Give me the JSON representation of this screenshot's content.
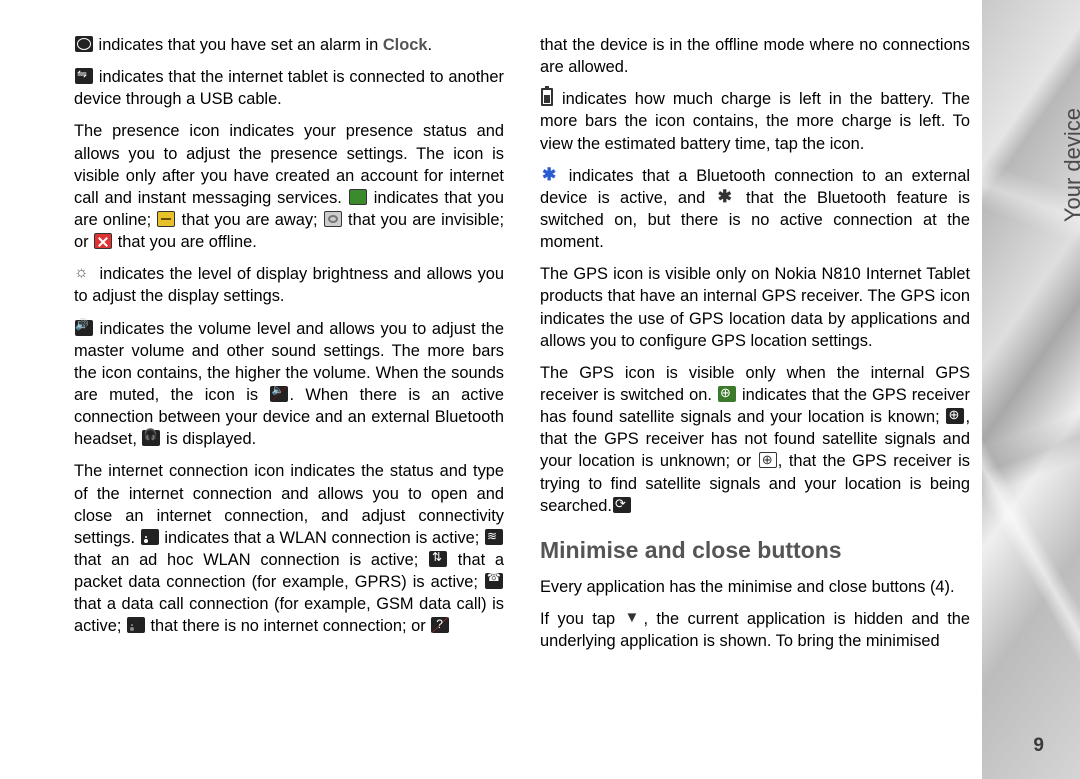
{
  "side_title": "Your device",
  "page_number": "9",
  "left": {
    "p1a": " indicates that you have set an alarm in ",
    "p1b": "Clock",
    "p1c": ".",
    "p2": " indicates that the internet tablet is connected to another device through a USB cable.",
    "p3a": "The presence icon indicates your presence status and allows you to adjust the presence settings. The icon is visible only after you have created an account for internet call and instant messaging services. ",
    "p3b": " indicates that you are online; ",
    "p3c": " that you are away; ",
    "p3d": " that you are invisible; or ",
    "p3e": " that you are offline.",
    "p4": " indicates the level of display brightness and allows you to adjust the display settings.",
    "p5a": " indicates the volume level and allows you to adjust the master volume and other sound settings. The more bars the icon contains, the higher the volume. When the sounds are muted, the icon is ",
    "p5b": ". When there is an active connection between your device and an external Bluetooth headset, ",
    "p5c": " is displayed.",
    "p6a": "The internet connection icon indicates the status and type of the internet connection and allows you to open and close an internet connection, and adjust connectivity settings. ",
    "p6b": " indicates that a WLAN connection is active; ",
    "p6c": " that an ad hoc WLAN connection is active; ",
    "p6d": " that a packet data connection (for example, GPRS) is active; ",
    "p6e": " that a data call connection (for example, GSM data call) is active; ",
    "p6f": " that there is no internet connection; or "
  },
  "right": {
    "p0": "that the device is in the offline mode where no connections are allowed.",
    "p1": " indicates how much charge is left in the battery. The more bars the icon contains, the more charge is left. To view the estimated battery time, tap the icon.",
    "p2a": " indicates that a Bluetooth connection to an external device is active, and ",
    "p2b": " that the Bluetooth feature is switched on, but there is no active connection at the moment.",
    "p3": "The GPS icon is visible only on Nokia N810 Internet Tablet products that have an internal GPS receiver. The GPS icon indicates the use of GPS location data by applications and allows you to configure GPS location settings.",
    "p4a": "The GPS icon is visible only when the internal GPS receiver is switched on. ",
    "p4b": " indicates that the GPS receiver has found satellite signals and your location is known; ",
    "p4c": ", that the GPS receiver has not found satellite signals and your location is unknown; or ",
    "p4d": ", that the GPS receiver is trying to find satellite signals and your location is being searched.",
    "h2": "Minimise and close buttons",
    "p5": "Every application has the minimise and close buttons (4).",
    "p6a": "If you tap ",
    "p6b": ", the current application is hidden and the underlying application is shown. To bring the minimised"
  }
}
